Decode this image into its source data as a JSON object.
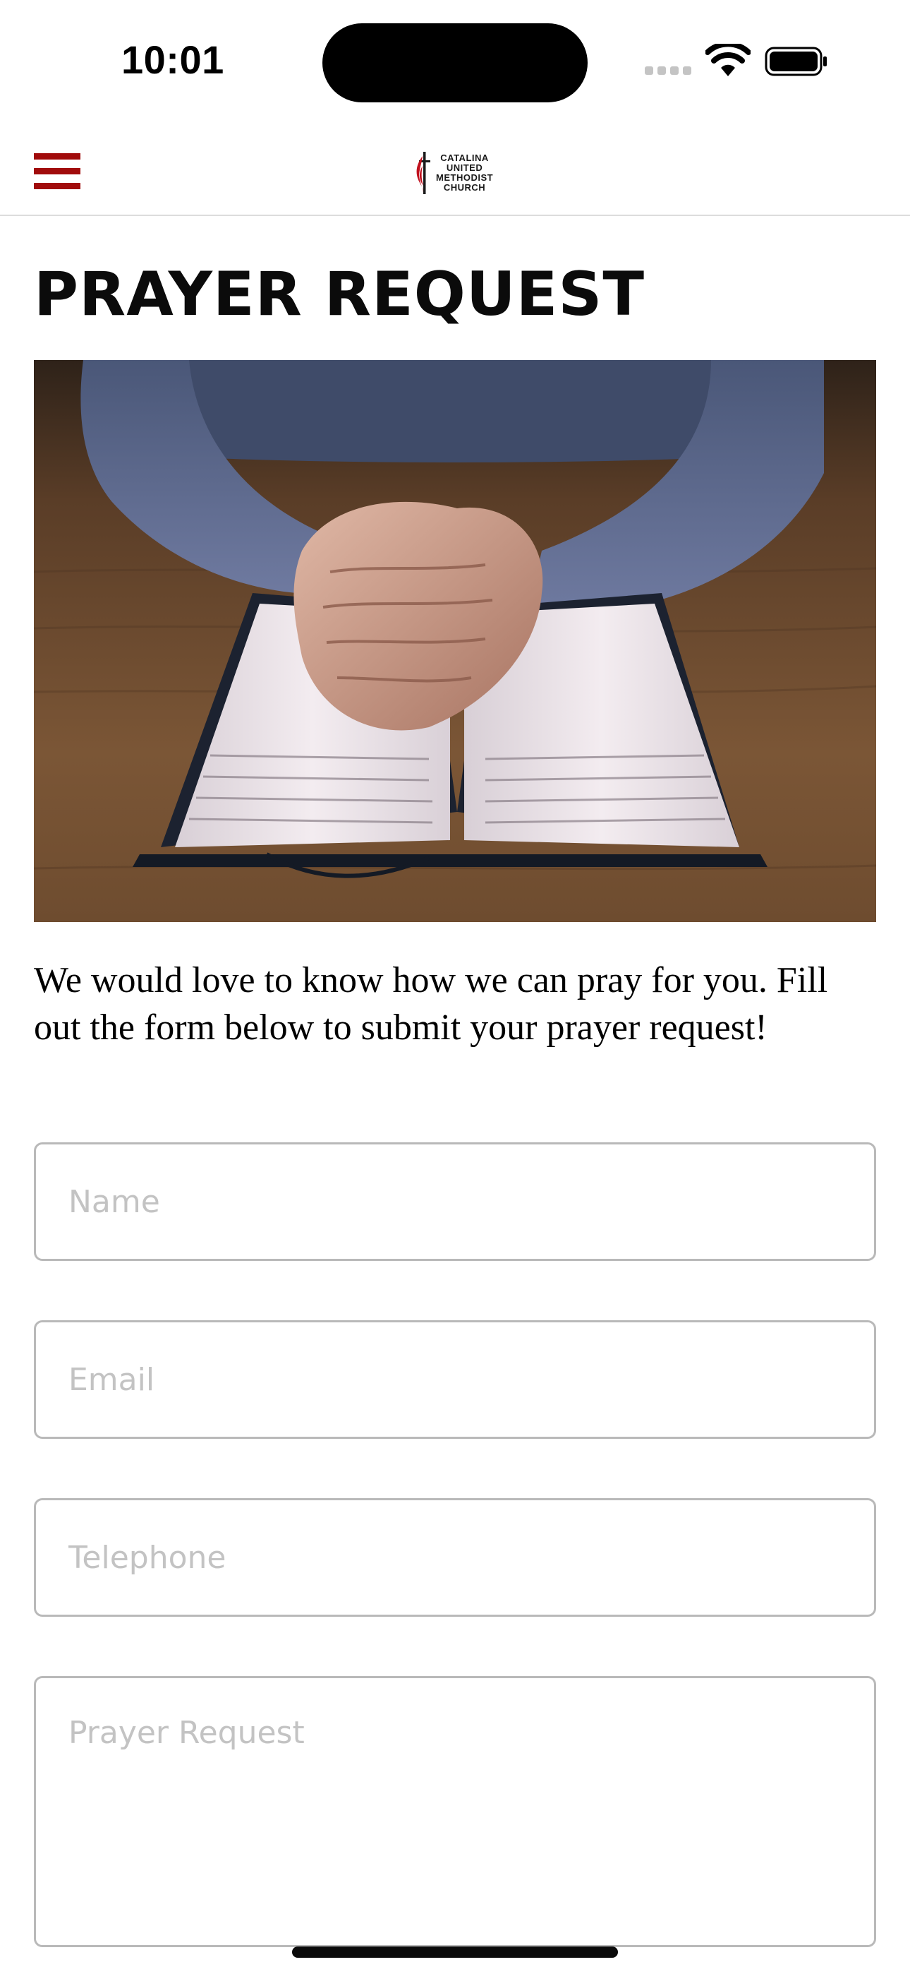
{
  "status_bar": {
    "time": "10:01"
  },
  "header": {
    "logo_lines": [
      "CATALINA",
      "UNITED",
      "METHODIST",
      "CHURCH"
    ],
    "menu_icon": "hamburger-menu-icon",
    "accent_color": "#a10b0b"
  },
  "page": {
    "title": "PRAYER REQUEST",
    "hero_image_alt": "Hands folded in prayer on an open Bible",
    "intro": "We would love to know how we can pray for you.  Fill out the form below to submit your prayer request!"
  },
  "form": {
    "name_placeholder": "Name",
    "email_placeholder": "Email",
    "telephone_placeholder": "Telephone",
    "prayer_request_placeholder": "Prayer Request"
  }
}
